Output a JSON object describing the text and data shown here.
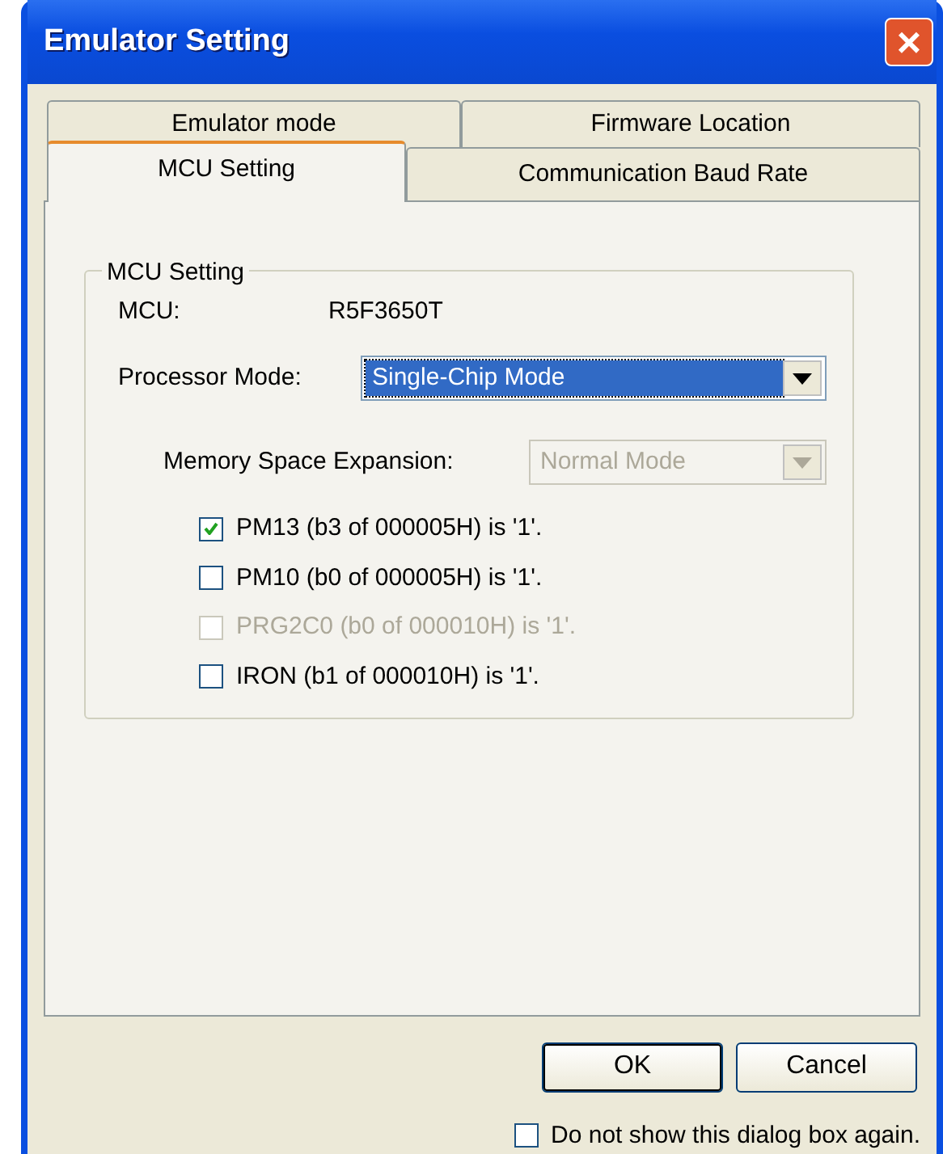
{
  "window": {
    "title": "Emulator Setting",
    "close": "×"
  },
  "tab_rows": [
    [
      {
        "label": "Emulator mode",
        "selected": false
      },
      {
        "label": "Firmware Location",
        "selected": false
      }
    ],
    [
      {
        "label": "MCU Setting",
        "selected": true
      },
      {
        "label": "Communication Baud Rate",
        "selected": false
      }
    ]
  ],
  "group": {
    "title": "MCU Setting",
    "mcu": {
      "label": "MCU:",
      "value": "R5F3650T"
    },
    "processor_mode": {
      "label": "Processor Mode:",
      "value": "Single-Chip Mode",
      "disabled": false
    },
    "memory_expansion": {
      "label": "Memory Space Expansion:",
      "value": "Normal Mode",
      "disabled": true
    },
    "checkboxes": [
      {
        "label": "PM13 (b3 of 000005H) is '1'.",
        "checked": true,
        "disabled": false
      },
      {
        "label": "PM10 (b0 of 000005H) is '1'.",
        "checked": false,
        "disabled": false
      },
      {
        "label": "PRG2C0 (b0 of 000010H) is '1'.",
        "checked": false,
        "disabled": true
      },
      {
        "label": "IRON (b1 of 000010H) is '1'.",
        "checked": false,
        "disabled": false
      }
    ]
  },
  "buttons": [
    {
      "label": "OK",
      "default": true
    },
    {
      "label": "Cancel",
      "default": false
    }
  ],
  "dont_show": {
    "label": "Do not show this dialog box again.",
    "checked": false
  }
}
